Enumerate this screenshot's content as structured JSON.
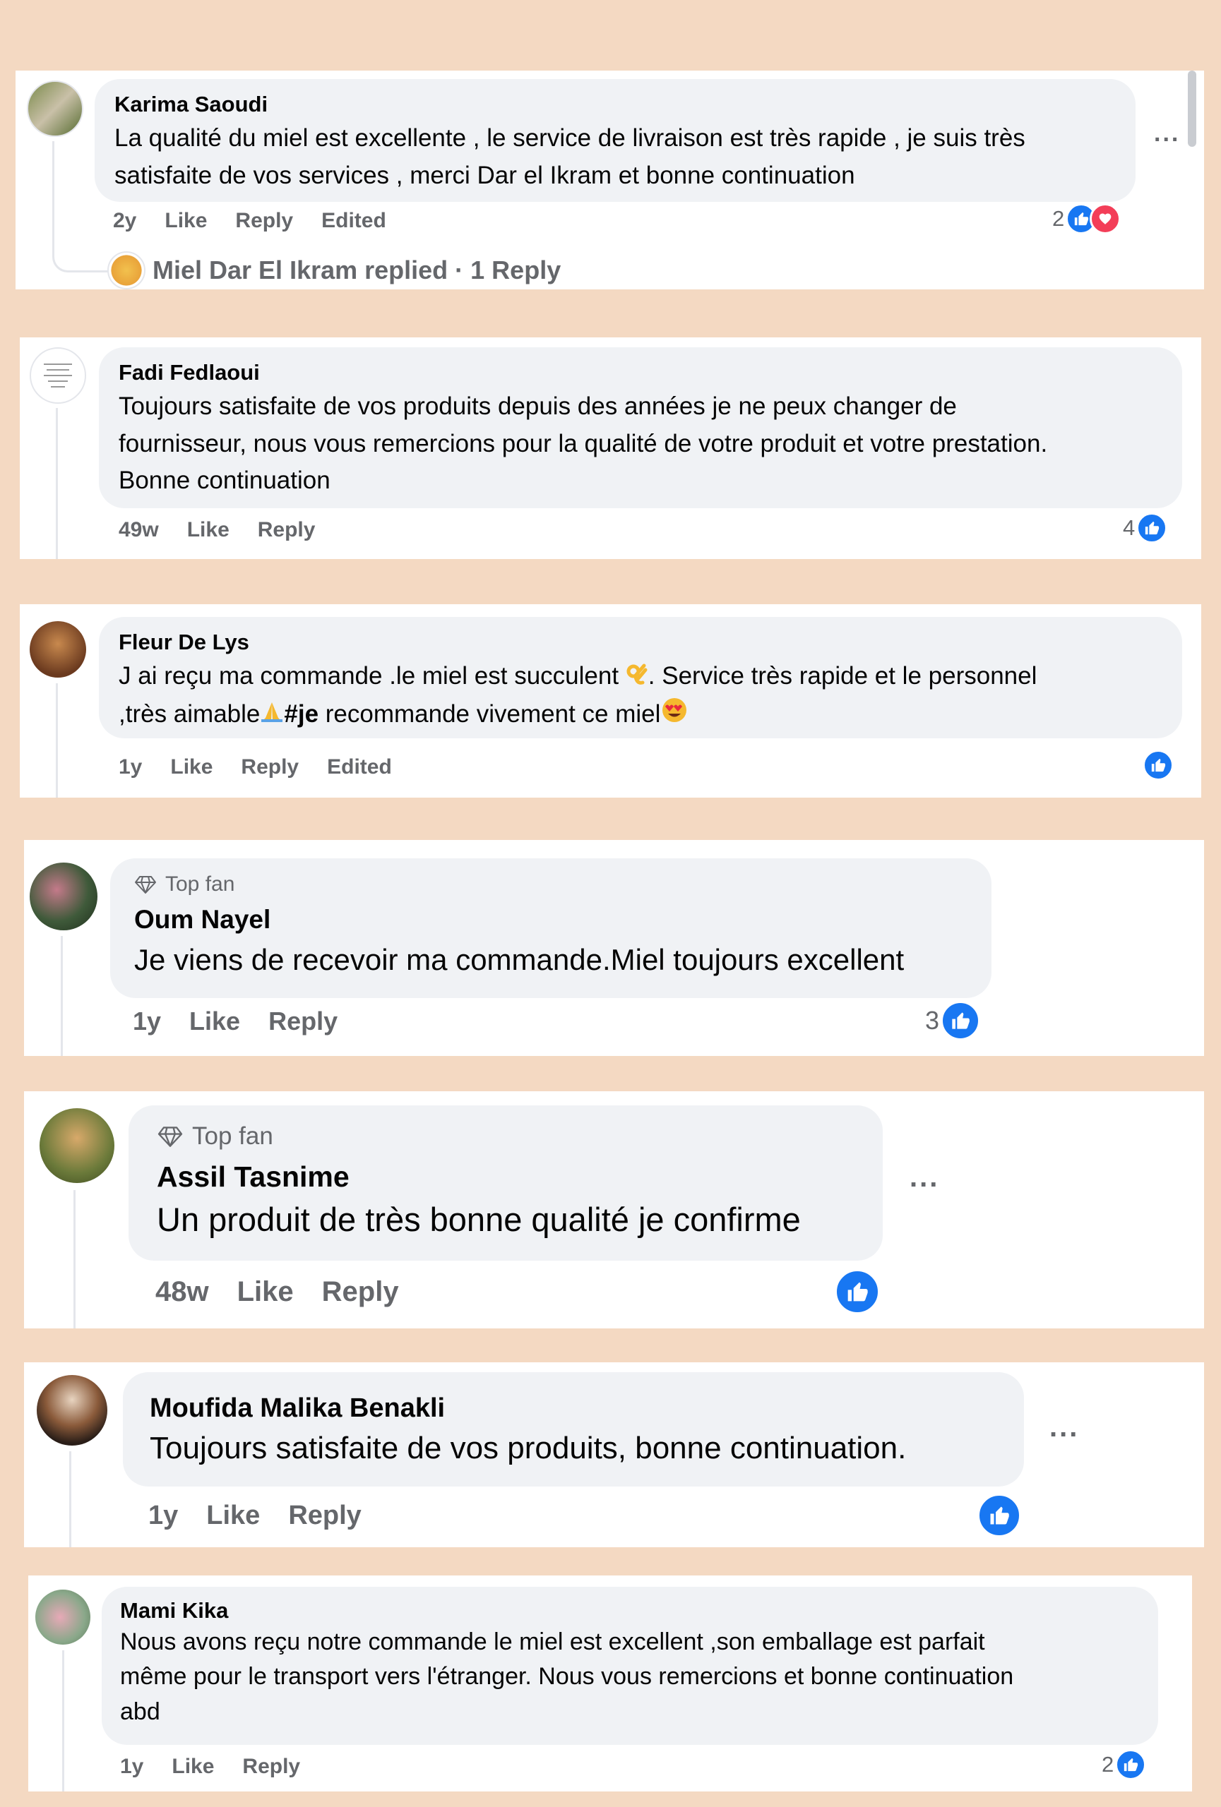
{
  "comments": [
    {
      "author": "Karima Saoudi",
      "text_lines": [
        "La qualité du miel est excellente , le service de livraison est très rapide , je suis très",
        "satisfaite de vos services , merci Dar el Ikram et bonne continuation"
      ],
      "time": "2y",
      "like": "Like",
      "reply": "Reply",
      "edited": "Edited",
      "reaction_count": "2",
      "more": "...",
      "replies_summary": "Miel Dar El Ikram replied · 1 Reply"
    },
    {
      "author": "Fadi Fedlaoui",
      "text_lines": [
        "Toujours satisfaite de vos produits depuis des années je ne peux changer de",
        "fournisseur, nous vous remercions pour la qualité de votre produit et votre prestation.",
        "Bonne continuation"
      ],
      "time": "49w",
      "like": "Like",
      "reply": "Reply",
      "reaction_count": "4"
    },
    {
      "author": "Fleur De Lys",
      "text_part1": "J ai reçu ma commande .le miel est succulent ",
      "text_part2": ". Service très rapide et le personnel",
      "text_part3": ",très aimable",
      "hashtag": "#je",
      "text_part4": " recommande vivement ce miel",
      "time": "1y",
      "like": "Like",
      "reply": "Reply",
      "edited": "Edited"
    },
    {
      "badge": "Top fan",
      "author": "Oum Nayel",
      "text": "Je viens de recevoir ma commande.Miel toujours excellent",
      "time": "1y",
      "like": "Like",
      "reply": "Reply",
      "reaction_count": "3"
    },
    {
      "badge": "Top fan",
      "author": "Assil Tasnime",
      "text": "Un produit de très bonne qualité je confirme",
      "time": "48w",
      "like": "Like",
      "reply": "Reply",
      "more": "..."
    },
    {
      "author": "Moufida Malika Benakli",
      "text": "Toujours satisfaite de vos produits, bonne continuation.",
      "time": "1y",
      "like": "Like",
      "reply": "Reply",
      "more": "..."
    },
    {
      "author": "Mami Kika",
      "text_lines": [
        "Nous avons reçu notre commande le miel est excellent ,son emballage est parfait",
        "même pour le transport vers l'étranger. Nous vous remercions et bonne continuation",
        "abd"
      ],
      "time": "1y",
      "like": "Like",
      "reply": "Reply",
      "reaction_count": "2"
    }
  ],
  "icons": {
    "like": "thumbs-up-icon",
    "love": "heart-icon",
    "top_fan": "diamond-icon",
    "ok_hand": "ok-hand-emoji",
    "pray": "pray-emoji",
    "heart_eyes": "heart-eyes-emoji"
  },
  "colors": {
    "background": "#f4d9c2",
    "like_blue": "#1877f2",
    "love_red": "#f33e58",
    "bubble": "#f0f2f5",
    "meta_gray": "#65676b"
  }
}
